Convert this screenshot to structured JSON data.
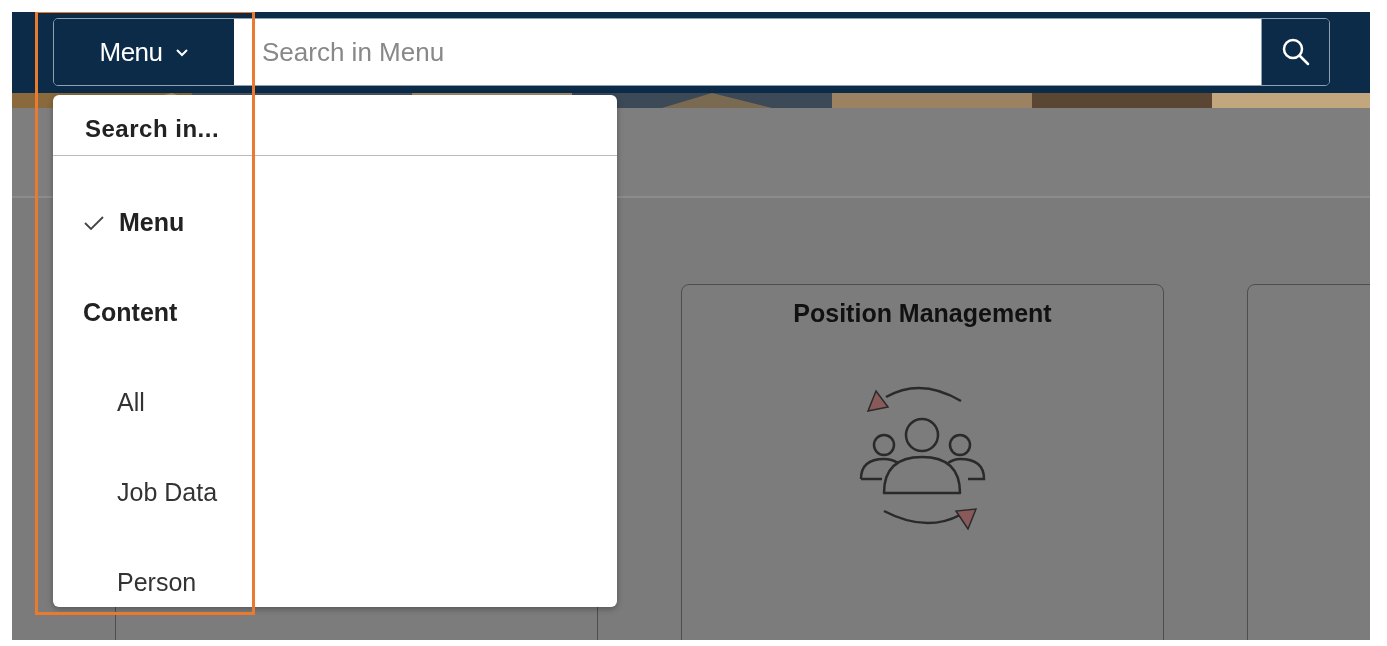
{
  "search": {
    "menu_button": "Menu",
    "placeholder": "Search in Menu"
  },
  "dropdown": {
    "heading": "Search in...",
    "items": [
      {
        "kind": "option",
        "label": "Menu",
        "selected": true
      },
      {
        "kind": "group",
        "label": "Content"
      },
      {
        "kind": "option",
        "label": "All",
        "selected": false
      },
      {
        "kind": "option",
        "label": "Job Data",
        "selected": false
      },
      {
        "kind": "option",
        "label": "Person",
        "selected": false
      }
    ]
  },
  "tiles": [
    {
      "title": "Position Management"
    }
  ]
}
